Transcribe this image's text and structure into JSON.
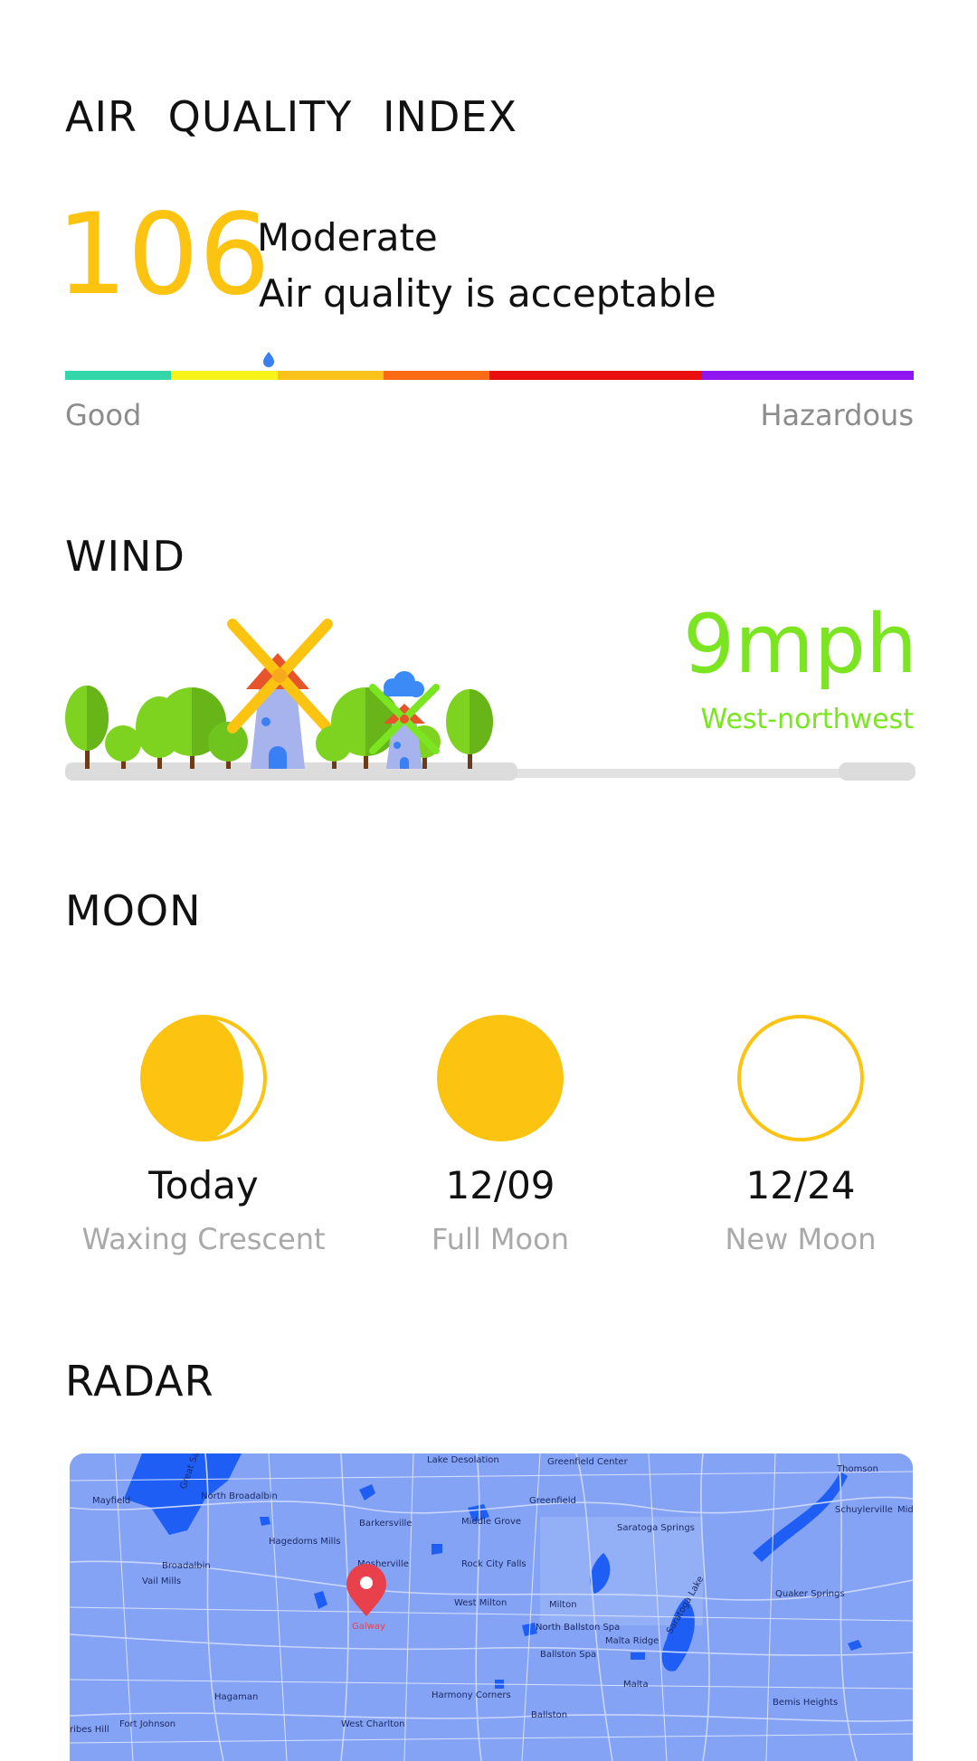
{
  "aqi": {
    "title": "AIR  QUALITY  INDEX",
    "value": "106",
    "level": "Moderate",
    "description": "Air quality is acceptable",
    "scale_low_label": "Good",
    "scale_high_label": "Hazardous",
    "indicator_position": 0.24,
    "scale_colors": [
      "#33d6a8",
      "#f8f31a",
      "#fbc21c",
      "#fb6a14",
      "#e90f0f",
      "#e90f0f",
      "#8f16ef",
      "#8f16ef"
    ],
    "value_color": "#fcc410"
  },
  "wind": {
    "title": "WIND",
    "speed": "9mph",
    "direction": "West-northwest",
    "accent_color": "#7ce521"
  },
  "moon": {
    "title": "MOON",
    "phases": [
      {
        "date": "Today",
        "phase": "Waxing Crescent",
        "icon": "waxing-crescent-moon-icon"
      },
      {
        "date": "12/09",
        "phase": "Full Moon",
        "icon": "full-moon-icon"
      },
      {
        "date": "12/24",
        "phase": "New Moon",
        "icon": "new-moon-icon"
      }
    ],
    "color": "#fcc410"
  },
  "radar": {
    "title": "RADAR",
    "pin_label": "Galway",
    "map_labels": [
      "Lake Desolation",
      "Greenfield Center",
      "Thomson",
      "Mayfield",
      "North Broadalbin",
      "Greenfield",
      "Barkersville",
      "Middle Grove",
      "Saratoga Springs",
      "Schuylerville",
      "Midd",
      "Hagedorns Mills",
      "Mosherville",
      "Rock City Falls",
      "Broadalbin",
      "Vail Mills",
      "West Milton",
      "Milton",
      "Quaker Springs",
      "North Ballston Spa",
      "Malta Ridge",
      "Ballston Spa",
      "Saratoga Lake",
      "Hagaman",
      "Harmony Corners",
      "Malta",
      "Bemis Heights",
      "Fort Johnson",
      "West Charlton",
      "Ballston",
      "ribes Hill",
      "Great Sa"
    ]
  }
}
